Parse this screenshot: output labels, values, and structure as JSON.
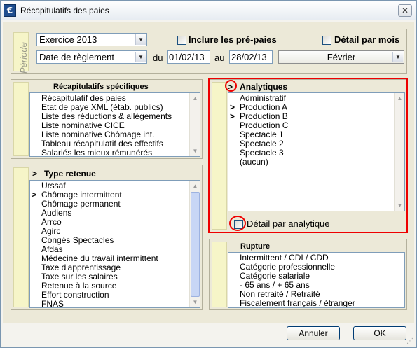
{
  "window": {
    "title": "Récapitulatifs des paies",
    "app_icon": "€",
    "close_glyph": "✕"
  },
  "periode": {
    "label": "Période",
    "exercice": "Exercice 2013",
    "date_type": "Date de règlement",
    "du_label": "du",
    "au_label": "au",
    "date_from": "01/02/13",
    "date_to": "28/02/13",
    "month": "Février",
    "inclure_prepaies": "Inclure les pré-paies",
    "detail_mois": "Détail par mois"
  },
  "recap_specifiques": {
    "header": "Récapitulatifs spécifiques",
    "items": [
      "Récapitulatif des paies",
      "Etat de paye XML (étab. publics)",
      "Liste des réductions & allégements",
      "Liste nominative CICE",
      "Liste nominative Chômage int.",
      "Tableau récapitulatif des effectifs",
      "Salariés les mieux rémunérés"
    ]
  },
  "type_retenue": {
    "header": "Type retenue",
    "marker": ">",
    "items": [
      {
        "label": "Urssaf",
        "marker": ""
      },
      {
        "label": "Chômage intermittent",
        "marker": ">"
      },
      {
        "label": "Chômage permanent",
        "marker": ""
      },
      {
        "label": "Audiens",
        "marker": ""
      },
      {
        "label": "Arrco",
        "marker": ""
      },
      {
        "label": "Agirc",
        "marker": ""
      },
      {
        "label": "Congés Spectacles",
        "marker": ""
      },
      {
        "label": "Afdas",
        "marker": ""
      },
      {
        "label": "Médecine du travail intermittent",
        "marker": ""
      },
      {
        "label": "Taxe d'apprentissage",
        "marker": ""
      },
      {
        "label": "Taxe sur les salaires",
        "marker": ""
      },
      {
        "label": "Retenue à la source",
        "marker": ""
      },
      {
        "label": "Effort construction",
        "marker": ""
      },
      {
        "label": "FNAS",
        "marker": ""
      }
    ]
  },
  "analytiques": {
    "header": "Analytiques",
    "marker": ">",
    "items": [
      {
        "label": "Administratif",
        "marker": ""
      },
      {
        "label": "Production A",
        "marker": ">"
      },
      {
        "label": "Production B",
        "marker": ">"
      },
      {
        "label": "Production C",
        "marker": ""
      },
      {
        "label": "Spectacle 1",
        "marker": ""
      },
      {
        "label": "Spectacle 2",
        "marker": ""
      },
      {
        "label": "Spectacle 3",
        "marker": ""
      },
      {
        "label": "(aucun)",
        "marker": ""
      }
    ],
    "detail_label": "Détail par analytique"
  },
  "rupture": {
    "header": "Rupture",
    "items": [
      "Intermittent / CDI / CDD",
      "Catégorie professionnelle",
      "Catégorie salariale",
      "- 65 ans / + 65 ans",
      "Non retraité / Retraité",
      "Fiscalement français / étranger"
    ]
  },
  "footer": {
    "cancel": "Annuler",
    "ok": "OK"
  },
  "colors": {
    "highlight": "#e00000",
    "strip": "#f6f5c8",
    "panel": "#ece9d8"
  }
}
